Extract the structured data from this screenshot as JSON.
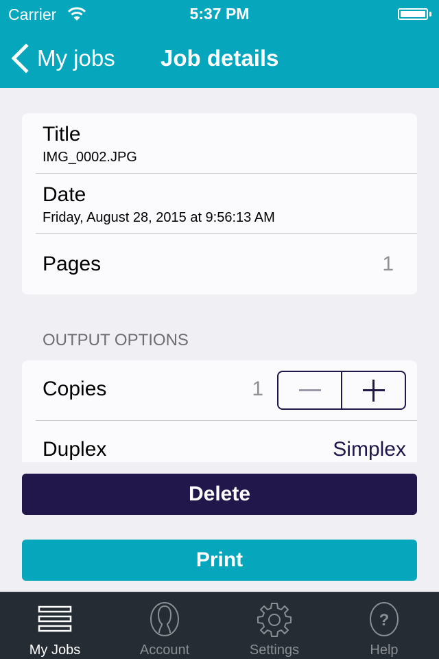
{
  "status_bar": {
    "carrier": "Carrier",
    "time": "5:37 PM",
    "wifi_icon": "wifi-icon",
    "battery_icon": "battery-icon"
  },
  "nav": {
    "back_label": "My jobs",
    "back_icon": "chevron-left-icon",
    "title": "Job details"
  },
  "details": {
    "title_label": "Title",
    "title_value": "IMG_0002.JPG",
    "date_label": "Date",
    "date_value": "Friday, August 28, 2015 at 9:56:13 AM",
    "pages_label": "Pages",
    "pages_value": "1"
  },
  "output_options": {
    "header": "OUTPUT OPTIONS",
    "copies_label": "Copies",
    "copies_value": "1",
    "duplex_label": "Duplex",
    "duplex_value": "Simplex"
  },
  "actions": {
    "delete_label": "Delete",
    "print_label": "Print"
  },
  "colors": {
    "brand_teal": "#06a7bd",
    "brand_dark": "#21174a",
    "tab_bar_bg": "#252c33"
  },
  "tabs": [
    {
      "label": "My Jobs",
      "icon": "list-icon",
      "active": true
    },
    {
      "label": "Account",
      "icon": "user-icon",
      "active": false
    },
    {
      "label": "Settings",
      "icon": "gear-icon",
      "active": false
    },
    {
      "label": "Help",
      "icon": "help-icon",
      "active": false
    }
  ]
}
